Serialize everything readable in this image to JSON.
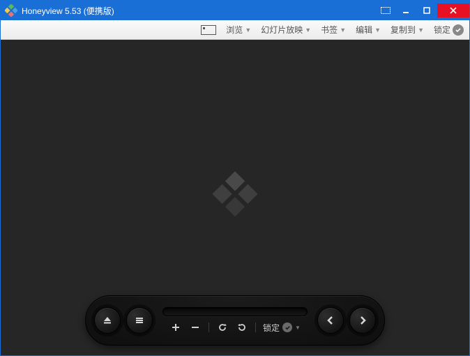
{
  "titlebar": {
    "title": "Honeyview 5.53 (便携版)"
  },
  "toolbar": {
    "browse": "浏览",
    "slideshow": "幻灯片放映",
    "bookmarks": "书签",
    "edit": "编辑",
    "copyto": "复制到",
    "lock": "锁定"
  },
  "controlbar": {
    "lock": "锁定"
  }
}
